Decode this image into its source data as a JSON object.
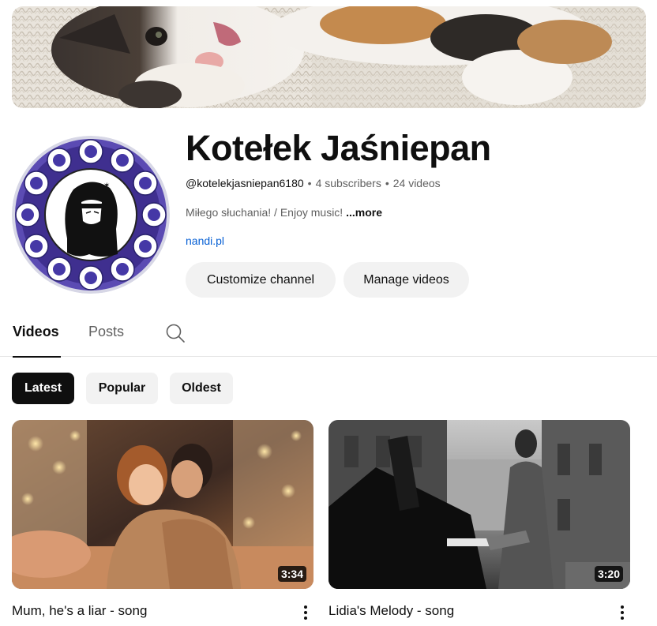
{
  "channel": {
    "name": "Kotełek Jaśniepan",
    "handle": "@kotelekjasniepan6180",
    "subscribers": "4 subscribers",
    "videos_count": "24 videos",
    "separator": "•",
    "description": "Miłego słuchania! / Enjoy music!",
    "more_label": "...more",
    "link": "nandi.pl"
  },
  "actions": {
    "customize_label": "Customize channel",
    "manage_label": "Manage videos"
  },
  "tabs": [
    {
      "label": "Videos",
      "active": true
    },
    {
      "label": "Posts",
      "active": false
    }
  ],
  "filters": [
    {
      "label": "Latest",
      "selected": true
    },
    {
      "label": "Popular",
      "selected": false
    },
    {
      "label": "Oldest",
      "selected": false
    }
  ],
  "videos": [
    {
      "title": "Mum, he's a liar - song",
      "duration": "3:34"
    },
    {
      "title": "Lidia's Melody - song",
      "duration": "3:20"
    }
  ],
  "icons": {
    "search": "search-icon",
    "more_actions": "kebab-menu-icon"
  },
  "colors": {
    "link": "#065fd4",
    "chip_selected_bg": "#0f0f0f",
    "chip_bg": "#f2f2f2",
    "muted_text": "#606060"
  }
}
